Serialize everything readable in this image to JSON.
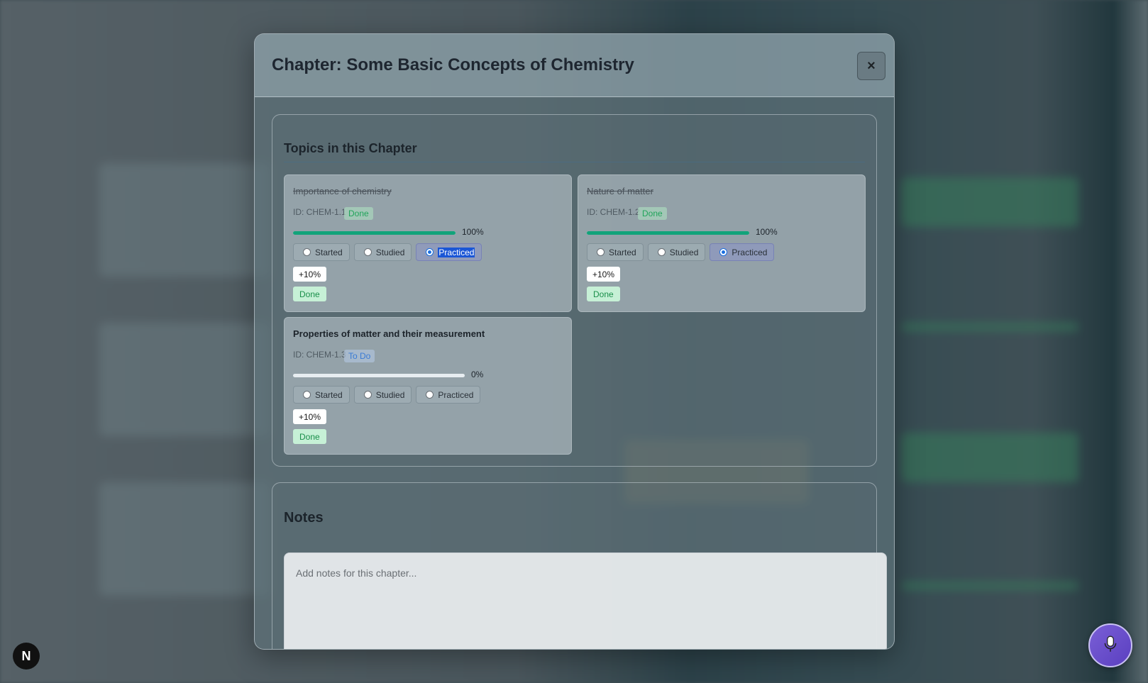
{
  "background": {
    "brand_letter": "N"
  },
  "modal": {
    "title": "Chapter: Some Basic Concepts of Chemistry",
    "close_label": "×"
  },
  "topics_section": {
    "title": "Topics in this Chapter",
    "radio_options": [
      "Started",
      "Studied",
      "Practiced"
    ],
    "plus_label": "+10%",
    "done_label": "Done",
    "topics": [
      {
        "name": "Importance of chemistry",
        "id": "ID: CHEM-1.1",
        "status": "Done",
        "progress": 1.0,
        "progress_label": "100%",
        "selected": "Practiced"
      },
      {
        "name": "Nature of matter",
        "id": "ID: CHEM-1.2",
        "status": "Done",
        "progress": 1.0,
        "progress_label": "100%",
        "selected": "Practiced"
      },
      {
        "name": "Properties of matter and their measurement",
        "id": "ID: CHEM-1.3",
        "status": "To Do",
        "progress": 0.0,
        "progress_label": "0%",
        "selected": ""
      }
    ]
  },
  "notes_section": {
    "title": "Notes",
    "placeholder": "Add notes for this chapter..."
  },
  "icons": {
    "close": "close-icon",
    "mic": "microphone-icon"
  },
  "colors": {
    "progress": "#12a37a",
    "done_badge_text": "#21a45a",
    "todo_badge_text": "#3a7bd5",
    "selected_radio": "#1a6fe0",
    "mic_button": "#6a4fcb"
  }
}
